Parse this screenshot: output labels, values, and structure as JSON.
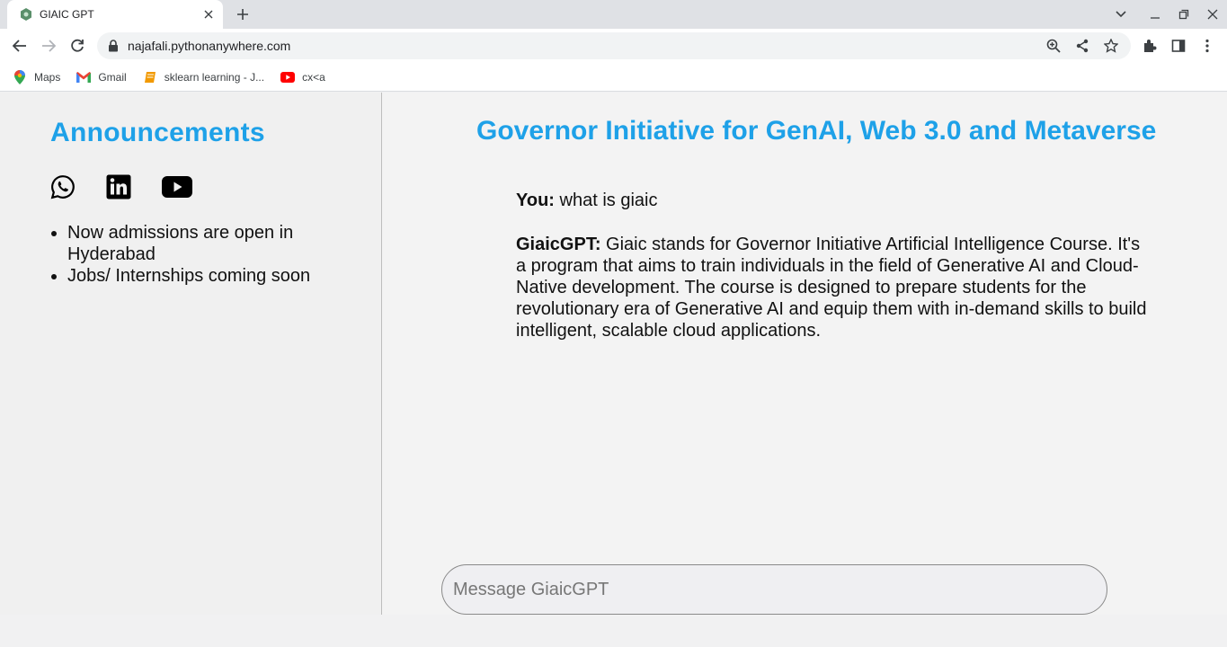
{
  "browser": {
    "tab_title": "GIAIC GPT",
    "url": "najafali.pythonanywhere.com",
    "bookmarks": [
      {
        "label": "Maps",
        "icon": "maps-icon"
      },
      {
        "label": "Gmail",
        "icon": "gmail-icon"
      },
      {
        "label": "sklearn learning - J...",
        "icon": "notebook-icon"
      },
      {
        "label": "cx<a",
        "icon": "youtube-icon"
      }
    ]
  },
  "sidebar": {
    "title": "Announcements",
    "social_icons": [
      "whatsapp-icon",
      "linkedin-icon",
      "youtube-icon"
    ],
    "items": [
      "Now admissions are open in Hyderabad",
      "Jobs/ Internships coming soon"
    ]
  },
  "main": {
    "title": "Governor Initiative for GenAI, Web 3.0 and Metaverse",
    "messages": [
      {
        "sender": "You:",
        "text": "what is giaic"
      },
      {
        "sender": "GiaicGPT:",
        "text": "Giaic stands for Governor Initiative Artificial Intelligence Course. It's a program that aims to train individuals in the field of Generative AI and Cloud-Native development. The course is designed to prepare students for the revolutionary era of Generative AI and equip them with in-demand skills to build intelligent, scalable cloud applications."
      }
    ],
    "input_placeholder": "Message GiaicGPT"
  },
  "colors": {
    "accent": "#1ea1e8",
    "sidebar_bg": "#f0f0f0",
    "main_bg": "#f3f3f3"
  }
}
